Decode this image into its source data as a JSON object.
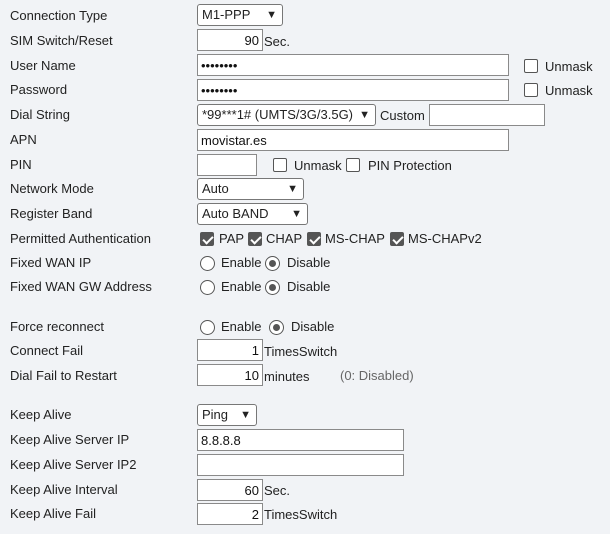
{
  "labels": {
    "connection_type": "Connection Type",
    "sim_switch": "SIM Switch/Reset",
    "user_name": "User Name",
    "password": "Password",
    "dial_string": "Dial String",
    "apn": "APN",
    "pin": "PIN",
    "network_mode": "Network Mode",
    "register_band": "Register Band",
    "permitted_auth": "Permitted Authentication",
    "fixed_wan_ip": "Fixed WAN IP",
    "fixed_wan_gw": "Fixed WAN GW Address",
    "force_reconnect": "Force reconnect",
    "connect_fail": "Connect Fail",
    "dial_fail_restart": "Dial Fail to Restart",
    "keep_alive": "Keep Alive",
    "keep_alive_ip": "Keep Alive Server IP",
    "keep_alive_ip2": "Keep Alive Server IP2",
    "keep_alive_interval": "Keep Alive Interval",
    "keep_alive_fail": "Keep Alive Fail"
  },
  "values": {
    "connection_type": "M1-PPP",
    "sim_switch": "90",
    "user_name": "••••••••",
    "password": "••••••••",
    "dial_string": "*99***1# (UMTS/3G/3.5G)",
    "custom_dial": "",
    "apn": "movistar.es",
    "pin": "",
    "network_mode": "Auto",
    "register_band": "Auto BAND",
    "connect_fail": "1",
    "dial_fail_restart": "10",
    "keep_alive": "Ping",
    "keep_alive_ip": "8.8.8.8",
    "keep_alive_ip2": "",
    "keep_alive_interval": "60",
    "keep_alive_fail": "2"
  },
  "units": {
    "sec": "Sec.",
    "times_switch": "TimesSwitch",
    "minutes": "minutes",
    "disabled_hint": "(0: Disabled)"
  },
  "text": {
    "unmask": "Unmask",
    "custom": "Custom",
    "pin_protection": "PIN Protection",
    "enable": "Enable",
    "disable": "Disable",
    "pap": "PAP",
    "chap": "CHAP",
    "ms_chap": "MS-CHAP",
    "ms_chapv2": "MS-CHAPv2",
    "dropdown_arrow": "▼"
  },
  "checks": {
    "pap": true,
    "chap": true,
    "ms_chap": true,
    "ms_chapv2": true,
    "unmask_user": false,
    "unmask_pass": false,
    "unmask_pin": false,
    "pin_protection": false
  },
  "radios": {
    "fixed_wan_ip": "Disable",
    "fixed_wan_gw": "Disable",
    "force_reconnect": "Disable"
  },
  "icons": {
    "dropdown": "chevron-down-icon",
    "checkbox": "checkbox-icon",
    "radio": "radio-icon"
  }
}
